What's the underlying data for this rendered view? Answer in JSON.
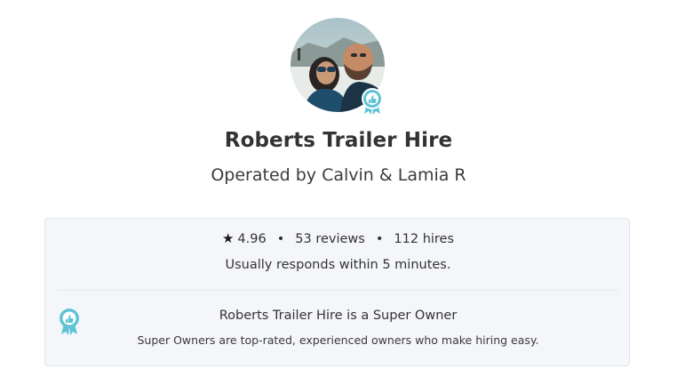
{
  "owner": {
    "avatar_icon": "avatar-photo",
    "badge_icon": "super-owner-badge-icon",
    "name": "Roberts Trailer Hire",
    "operated_by": "Operated by Calvin & Lamia R"
  },
  "stats": {
    "rating": "4.96",
    "reviews": "53 reviews",
    "hires": "112 hires",
    "separator": "•",
    "star_icon": "star-icon",
    "response": "Usually responds within 5 minutes."
  },
  "super_owner": {
    "title": "Roberts Trailer Hire is a Super Owner",
    "description": "Super Owners are top-rated, experienced owners who make hiring easy.",
    "badge_color": "#5fc3d6"
  },
  "colors": {
    "card_background": "#f5f6fa",
    "card_border": "#e2e4ea",
    "text": "#333333"
  }
}
